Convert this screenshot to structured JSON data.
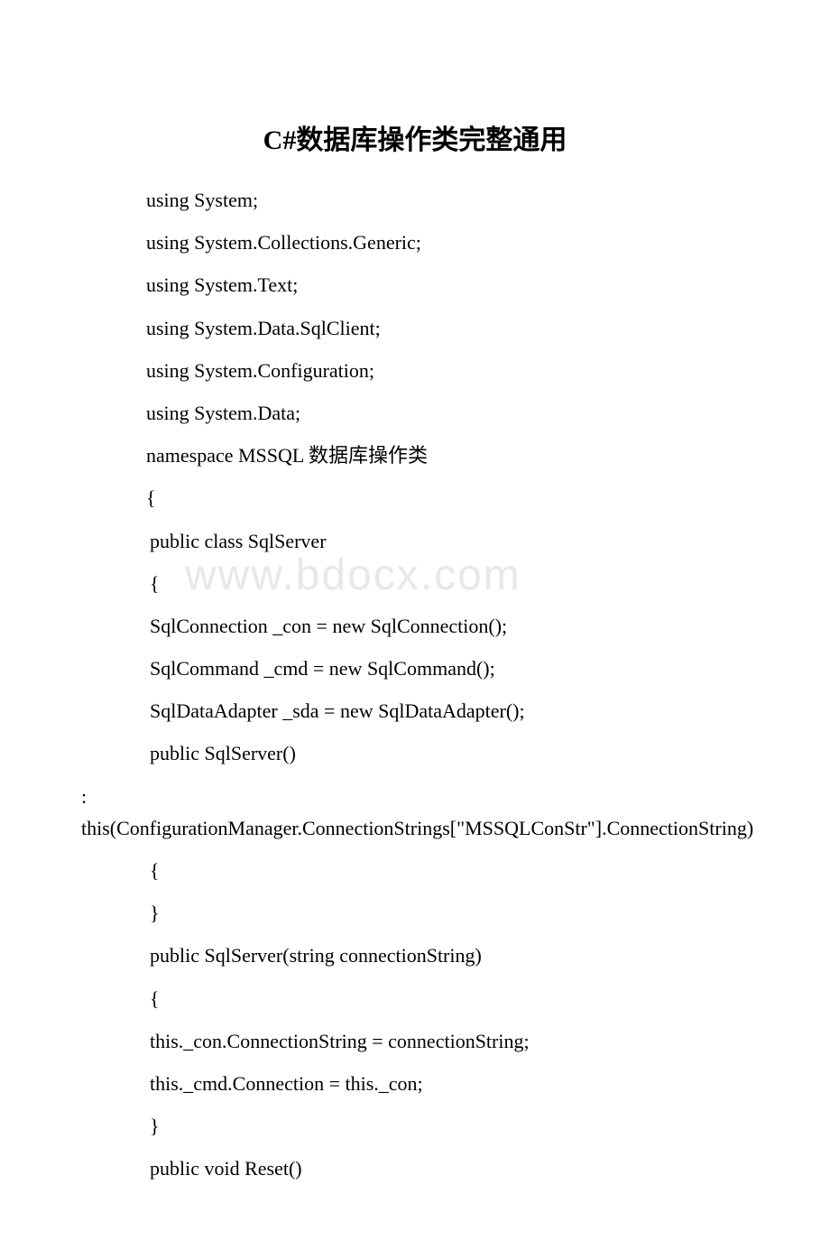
{
  "title": "C#数据库操作类完整通用",
  "watermark": "www.bdocx.com",
  "lines": [
    "using System;",
    "using System.Collections.Generic;",
    "using System.Text;",
    "using System.Data.SqlClient;",
    "using System.Configuration;",
    "using System.Data;",
    "namespace MSSQL 数据库操作类",
    "{",
    " public class SqlServer",
    " {",
    " SqlConnection _con = new SqlConnection();",
    " SqlCommand _cmd = new SqlCommand();",
    " SqlDataAdapter _sda = new SqlDataAdapter();",
    " public SqlServer()",
    " : this(ConfigurationManager.ConnectionStrings[\"MSSQLConStr\"].ConnectionString)",
    " {",
    " }",
    " public SqlServer(string connectionString)",
    " {",
    " this._con.ConnectionString = connectionString;",
    " this._cmd.Connection = this._con;",
    " }",
    " public void Reset()"
  ]
}
